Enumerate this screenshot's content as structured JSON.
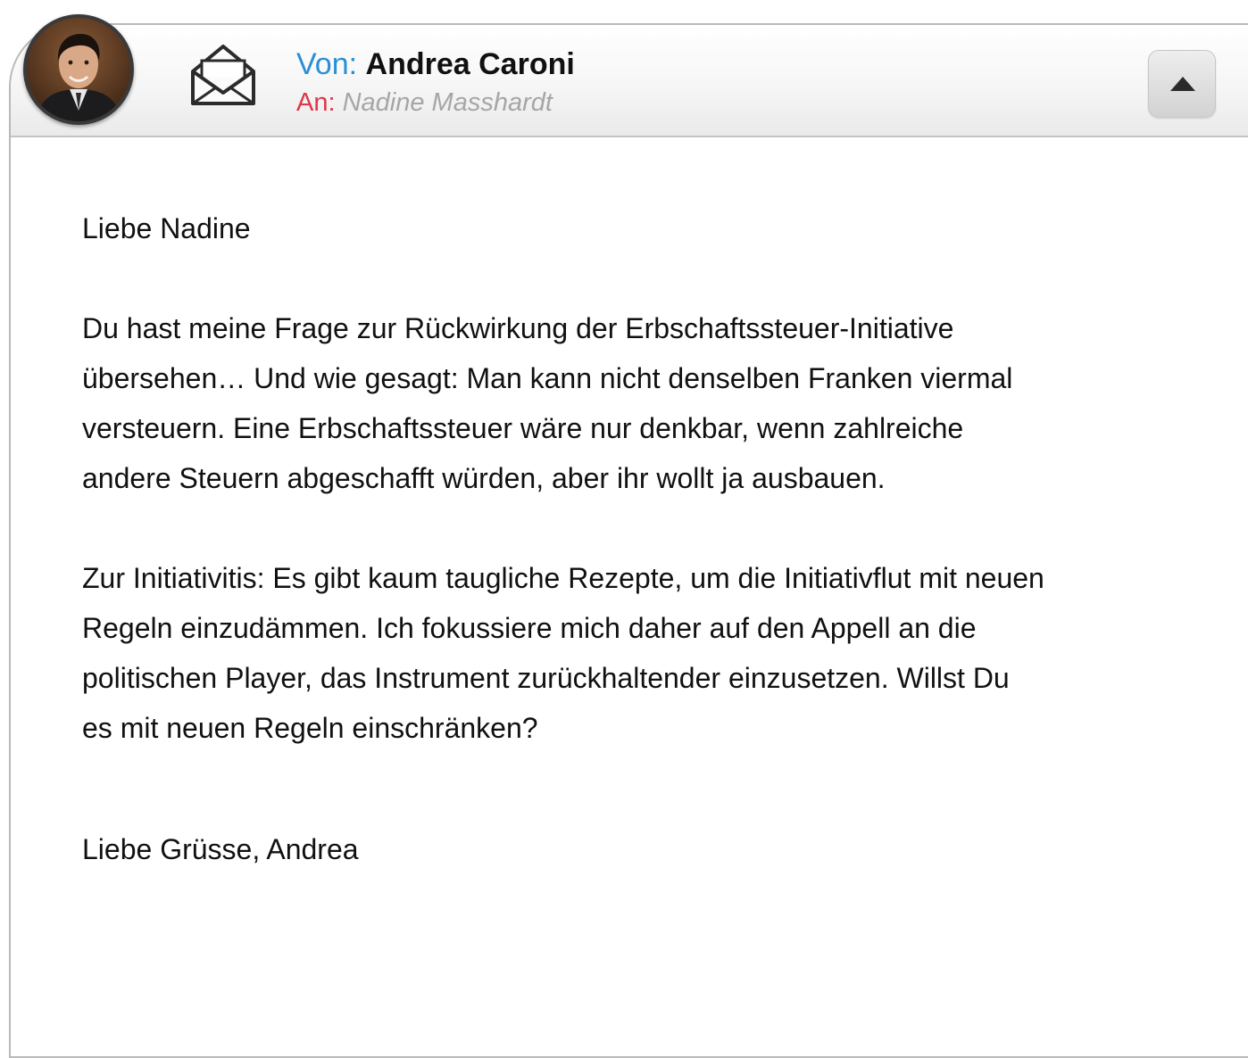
{
  "header": {
    "from_label": "Von:",
    "from_name": "Andrea Caroni",
    "to_label": "An:",
    "to_name": "Nadine Masshardt"
  },
  "icons": {
    "avatar": "avatar-photo",
    "envelope": "envelope-open-icon",
    "collapse": "triangle-up-icon"
  },
  "colors": {
    "from_label": "#2a8fd6",
    "to_label": "#e0364b",
    "to_name": "#a6a6a6"
  },
  "body": {
    "greeting": "Liebe Nadine",
    "paragraph1": "Du hast meine Frage zur Rückwirkung der Erbschaftssteuer-Initiative übersehen… Und wie gesagt: Man kann nicht denselben Franken viermal versteuern. Eine Erbschaftssteuer wäre nur denkbar, wenn zahlreiche andere Steuern abgeschafft würden, aber ihr wollt ja ausbauen.",
    "paragraph2": "Zur Initiativitis: Es gibt kaum taugliche Rezepte, um die Initiativflut mit neuen Regeln einzudämmen. Ich fokussiere mich daher auf den Appell an die politischen Player, das Instrument zurückhaltender einzusetzen. Willst Du es mit neuen Regeln einschränken?",
    "signoff": "Liebe Grüsse, Andrea"
  }
}
